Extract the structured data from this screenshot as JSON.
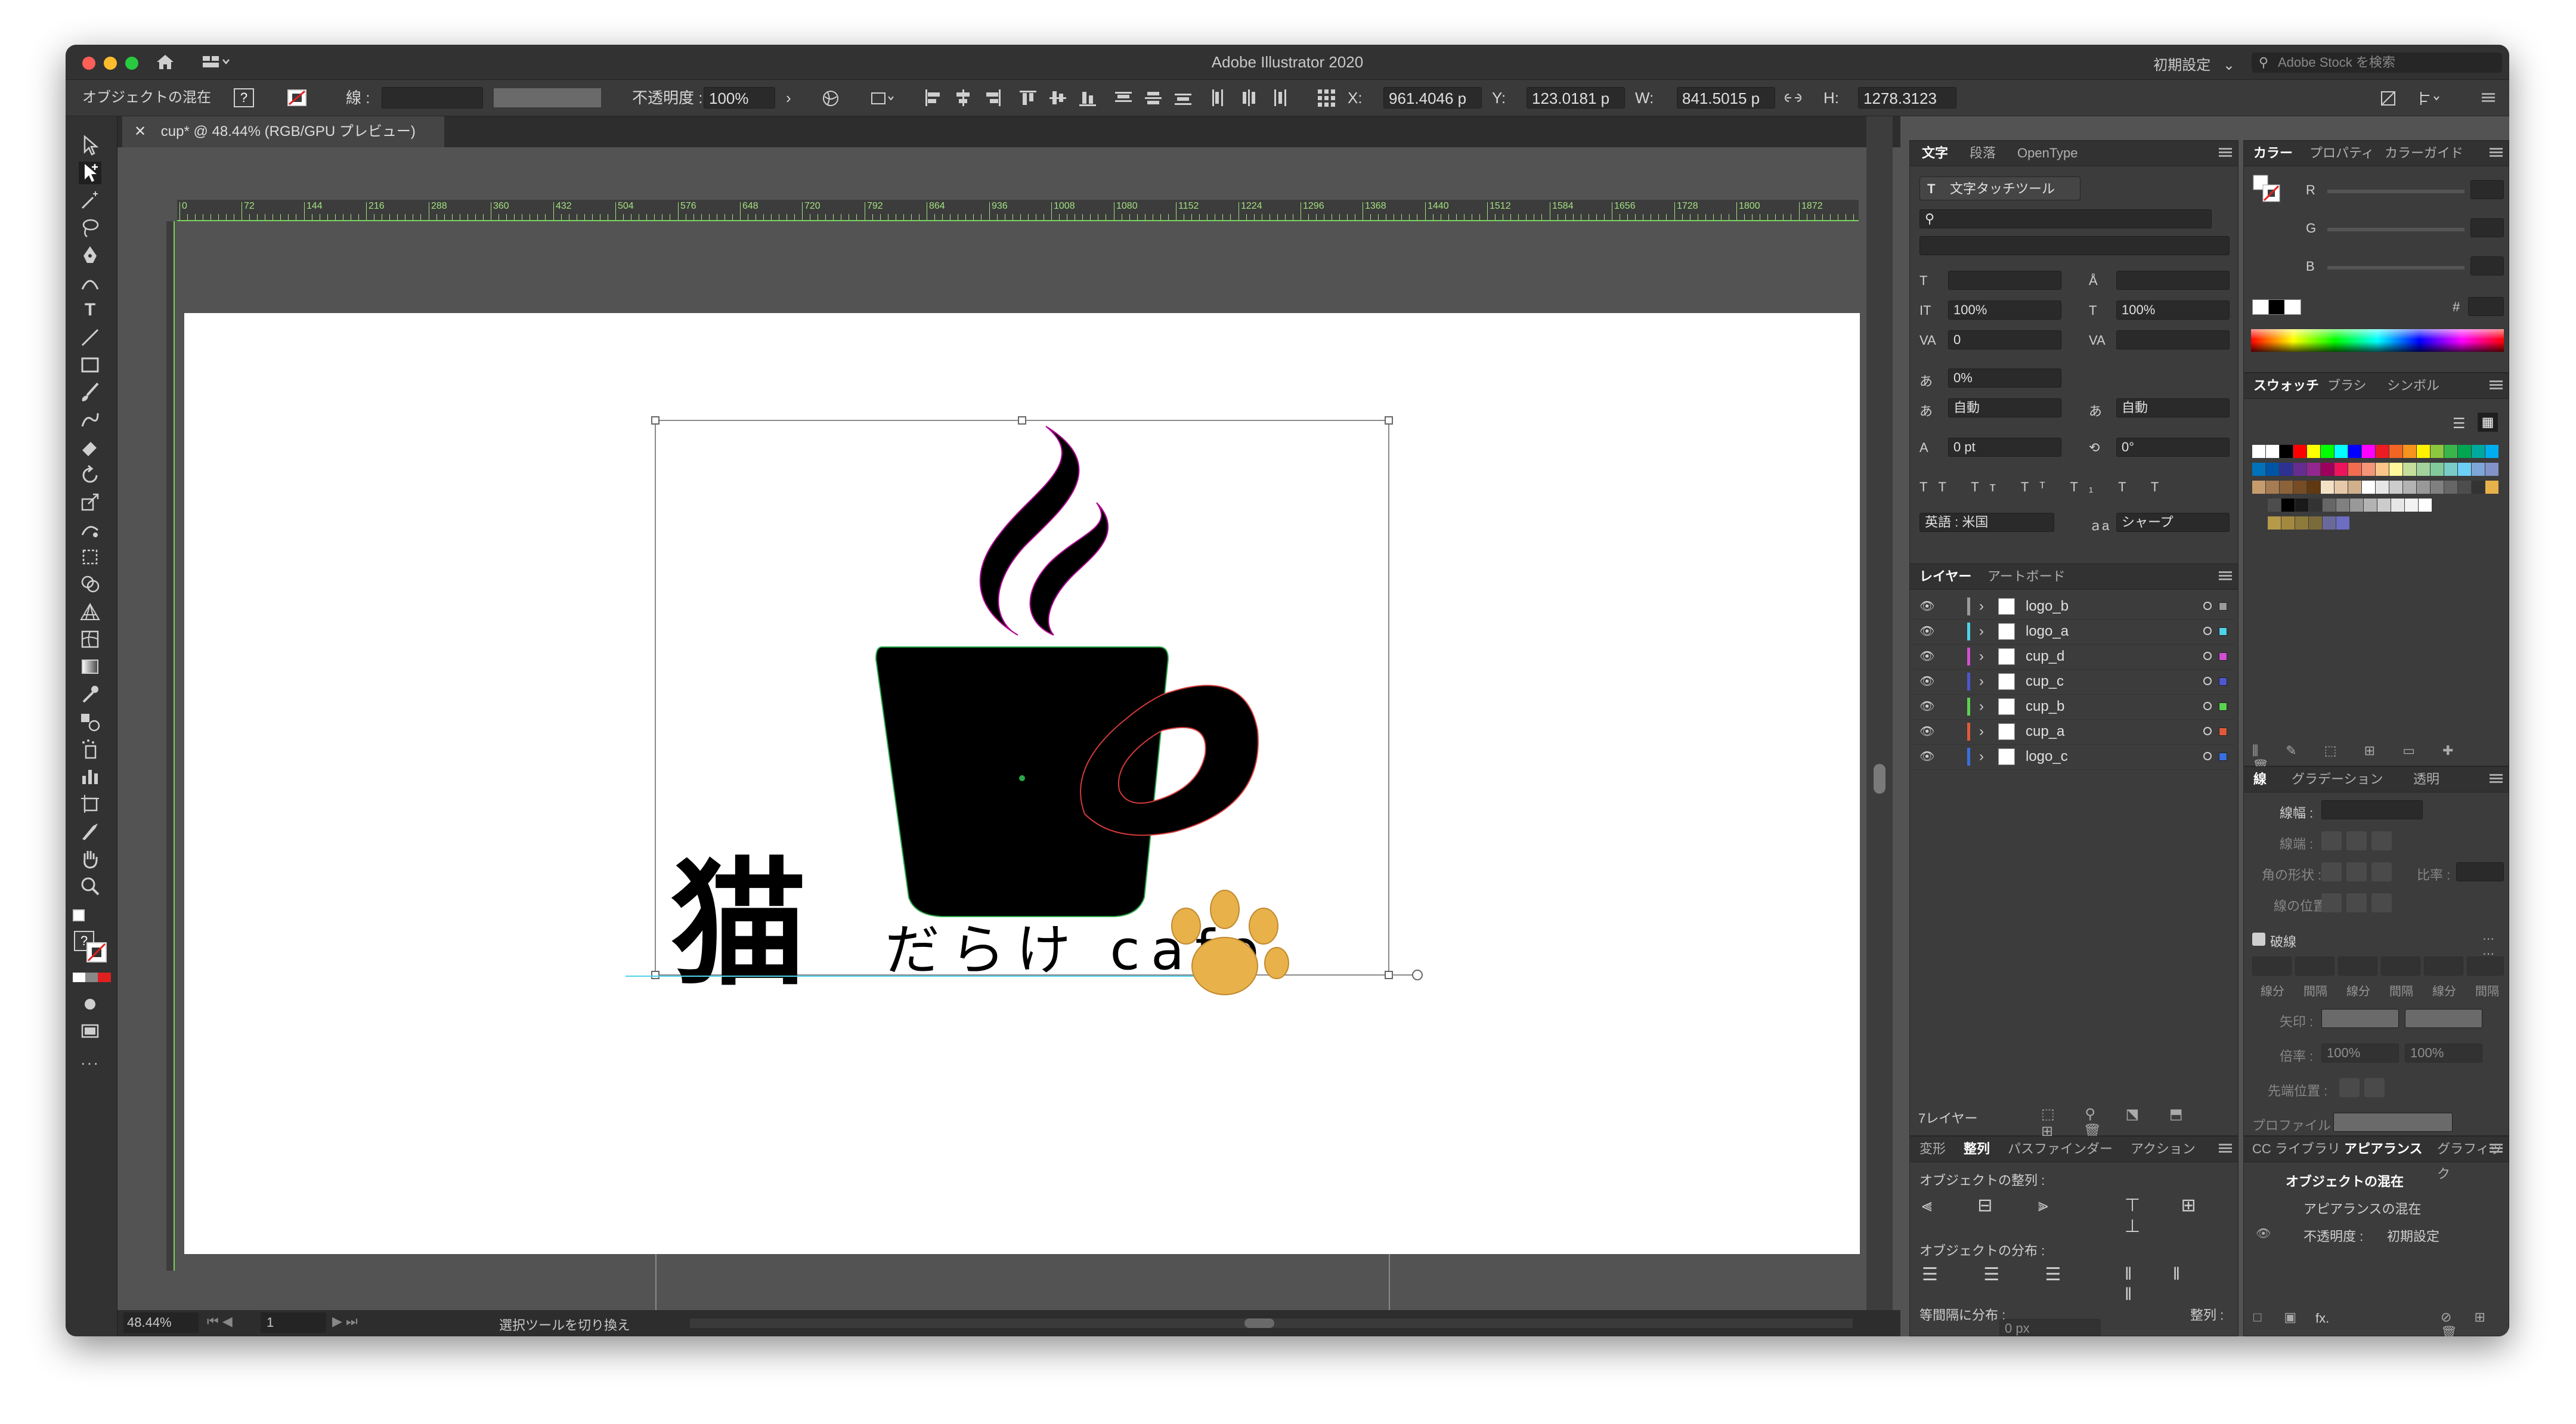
{
  "window": {
    "title": "Adobe Illustrator 2020",
    "workspace": "初期設定",
    "search_placeholder": "Adobe Stock を検索"
  },
  "control_bar": {
    "selection_label": "オブジェクトの混在",
    "stroke_label": "線 :",
    "opacity_label": "不透明度 :",
    "opacity_value": "100%",
    "x_label": "X:",
    "x_value": "961.4046 p",
    "y_label": "Y:",
    "y_value": "123.0181 p",
    "w_label": "W:",
    "w_value": "841.5015 p",
    "h_label": "H:",
    "h_value": "1278.3123"
  },
  "document": {
    "tab_label": "cup* @ 48.44% (RGB/GPU プレビュー)",
    "zoom": "48.44%",
    "artboard_number": "1",
    "status_text": "選択ツールを切り換え",
    "ruler_labels": [
      "0",
      "72",
      "144",
      "216",
      "288",
      "360",
      "432",
      "504",
      "576",
      "648",
      "720",
      "792",
      "864",
      "936",
      "1008",
      "1080",
      "1152",
      "1224",
      "1296",
      "1368",
      "1440",
      "1512",
      "1584",
      "1656",
      "1728",
      "1800",
      "1872"
    ]
  },
  "logo": {
    "kanji": "猫",
    "subtitle": "だらけ cafe",
    "paw_color": "#e8b14a"
  },
  "character_panel": {
    "tabs": [
      "文字",
      "段落",
      "OpenType"
    ],
    "touch_tool": "文字タッチツール",
    "vert_scale": "100%",
    "horiz_scale": "100%",
    "kerning": "0",
    "tsume": "0%",
    "aki_left": "自動",
    "aki_right": "自動",
    "baseline_shift": "0 pt",
    "rotation": "0°",
    "language": "英語 : 米国",
    "antialias": "シャープ"
  },
  "color_panel": {
    "tabs": [
      "カラー",
      "プロパティ",
      "カラーガイド"
    ],
    "r_label": "R",
    "g_label": "G",
    "b_label": "B",
    "hex_label": "#"
  },
  "swatch_panel": {
    "tabs": [
      "スウォッチ",
      "ブラシ",
      "シンボル"
    ]
  },
  "layers_panel": {
    "tabs": [
      "レイヤー",
      "アートボード"
    ],
    "layers": [
      {
        "name": "logo_b",
        "color": "#9b9b9b"
      },
      {
        "name": "logo_a",
        "color": "#4fd3e8"
      },
      {
        "name": "cup_d",
        "color": "#d24fd3"
      },
      {
        "name": "cup_c",
        "color": "#4f56d3"
      },
      {
        "name": "cup_b",
        "color": "#5ad34f"
      },
      {
        "name": "cup_a",
        "color": "#e05a3a"
      },
      {
        "name": "logo_c",
        "color": "#3a6ee0"
      }
    ],
    "count_label": "7レイヤー"
  },
  "stroke_panel": {
    "tabs": [
      "線",
      "グラデーション",
      "透明"
    ],
    "weight_label": "線幅 :",
    "cap_label": "線端 :",
    "corner_label": "角の形状 :",
    "ratio_label": "比率 :",
    "align_label": "線の位置 :",
    "dashed_label": "破線",
    "dash_labels": [
      "線分",
      "間隔",
      "線分",
      "間隔",
      "線分",
      "間隔"
    ],
    "arrow_label": "矢印 :",
    "scale_label": "倍率 :",
    "scale_value_1": "100%",
    "scale_value_2": "100%",
    "tip_label": "先端位置 :",
    "profile_label": "プロファイル :"
  },
  "align_panel": {
    "tabs": [
      "変形",
      "整列",
      "パスファインダー",
      "アクション"
    ],
    "align_objects": "オブジェクトの整列 :",
    "distribute_objects": "オブジェクトの分布 :",
    "distribute_spacing": "等間隔に分布 :",
    "align_to": "整列 :",
    "spacing_value": "0 px"
  },
  "appearance_panel": {
    "tabs": [
      "CC ライブラリ",
      "アピアランス",
      "グラフィック"
    ],
    "title": "オブジェクトの混在",
    "appearance_label": "アピアランスの混在",
    "opacity_label": "不透明度 :",
    "opacity_value": "初期設定",
    "fx": "fx."
  }
}
